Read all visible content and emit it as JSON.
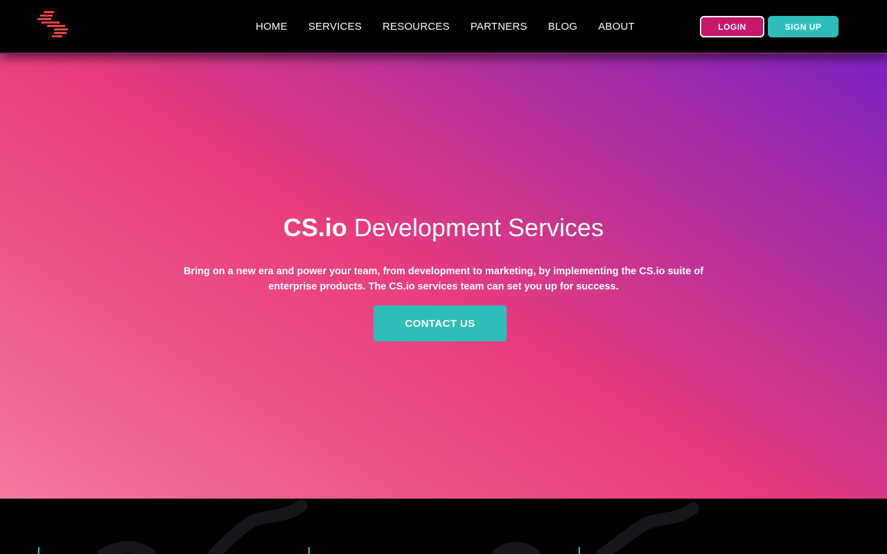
{
  "header": {
    "logo_icon": "cs-logo-icon",
    "nav": [
      {
        "label": "HOME"
      },
      {
        "label": "SERVICES"
      },
      {
        "label": "RESOURCES"
      },
      {
        "label": "PARTNERS"
      },
      {
        "label": "BLOG"
      },
      {
        "label": "ABOUT"
      }
    ],
    "login_label": "LOGIN",
    "signup_label": "SIGN UP"
  },
  "hero": {
    "title_brand": "CS.io",
    "title_rest": " Development Services",
    "description": "Bring on a new era and power your team, from development to marketing, by implementing the CS.io suite of enterprise products. The CS.io services team can set you up for success.",
    "cta_label": "CONTACT US"
  },
  "colors": {
    "accent_teal": "#2fbcb8",
    "accent_magenta": "#c7176c",
    "gradient_pink": "#e83c7e",
    "gradient_purple": "#7e22c2",
    "logo_red": "#e8453c"
  }
}
